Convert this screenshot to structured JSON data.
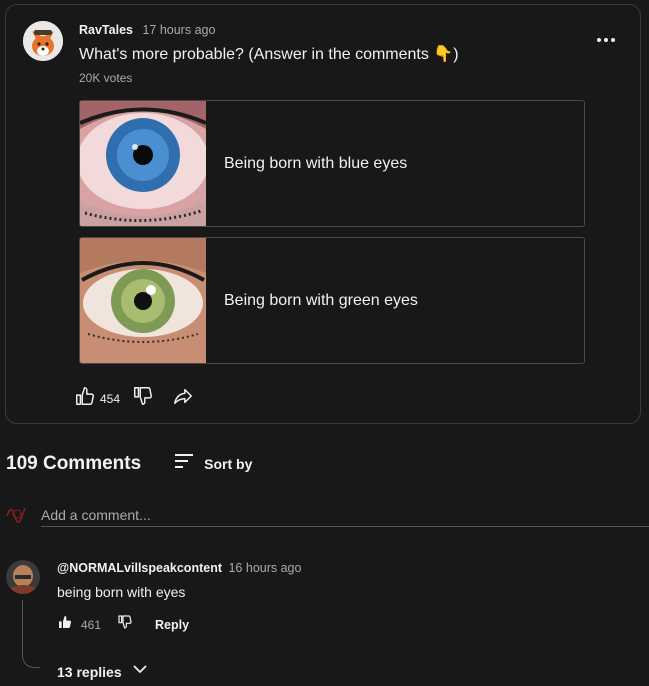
{
  "post": {
    "author": "RavTales",
    "time": "17 hours ago",
    "title": "What's more probable? (Answer in the comments 👇)",
    "votes": "20K votes",
    "options": [
      {
        "label": "Being born with blue eyes"
      },
      {
        "label": "Being born with green eyes"
      }
    ],
    "like_count": "454",
    "icons": {
      "more": "more-vert-icon",
      "like": "thumbs-up-icon",
      "dislike": "thumbs-down-icon",
      "share": "share-icon"
    }
  },
  "comments_section": {
    "count_label": "109 Comments",
    "sort_label": "Sort by",
    "add_placeholder": "Add a comment..."
  },
  "comment": {
    "author": "@NORMALvillspeakcontent",
    "time": "16 hours ago",
    "text": "being born with eyes",
    "like_count": "461",
    "reply_label": "Reply",
    "replies_label": "13 replies"
  }
}
